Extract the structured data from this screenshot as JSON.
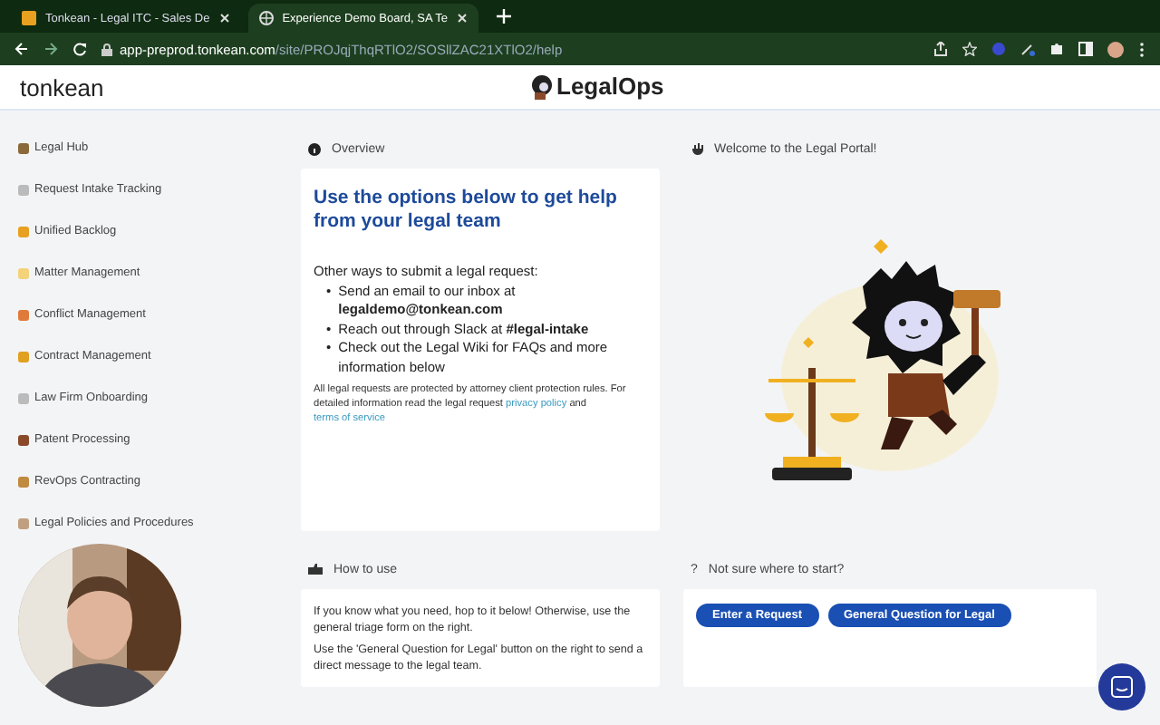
{
  "browser": {
    "tabs": [
      {
        "title": "Tonkean - Legal ITC - Sales De",
        "selected": false
      },
      {
        "title": "Experience Demo Board, SA Te",
        "selected": true
      }
    ],
    "url_host": "app-preprod.tonkean.com",
    "url_path": "/site/PROJqjThqRTlO2/SOSllZAC21XTlO2/help"
  },
  "header": {
    "brand": "tonkean",
    "logo_text": "LegalOps"
  },
  "sidebar": {
    "items": [
      {
        "label": "Legal Hub",
        "selected": false
      },
      {
        "label": "Request Intake Tracking",
        "selected": false
      },
      {
        "label": "Unified Backlog",
        "selected": false
      },
      {
        "label": "Matter Management",
        "selected": false
      },
      {
        "label": "Conflict Management",
        "selected": false
      },
      {
        "label": "Contract Management",
        "selected": false
      },
      {
        "label": "Law Firm Onboarding",
        "selected": false
      },
      {
        "label": "Patent Processing",
        "selected": false
      },
      {
        "label": "RevOps Contracting",
        "selected": false
      },
      {
        "label": "Legal Policies and Procedures",
        "selected": false
      }
    ]
  },
  "overview": {
    "heading": "Overview",
    "title": "Use the options below to get help from your legal team",
    "intro": "Other ways to submit a legal request:",
    "bullets": [
      {
        "marker": "•",
        "text": "Send an email to our inbox at **legaldemo@tonkean.com**"
      },
      {
        "marker": "•",
        "text": "Reach out through Slack at **#legal-intake**"
      },
      {
        "marker": "•",
        "text": "Check out the Legal Wiki for FAQs and more information below"
      }
    ],
    "note": "All legal requests are protected by attorney client protection rules. For detailed information read the legal request",
    "link_1": "privacy policy",
    "note_joiner": "and",
    "link_2": "terms of service"
  },
  "welcome": {
    "heading": "Welcome to the Legal Portal!"
  },
  "how_to_use": {
    "heading": "How to use",
    "paragraphs": [
      "If you know what you need, hop to it below!  Otherwise, use the general triage form on the right.",
      "Use the 'General Question for Legal' button on the right to send a direct message to the legal team."
    ]
  },
  "not_sure": {
    "icon": "?",
    "heading": "Not sure where to start?",
    "buttons": [
      "Enter a Request",
      "General Question for Legal"
    ]
  }
}
